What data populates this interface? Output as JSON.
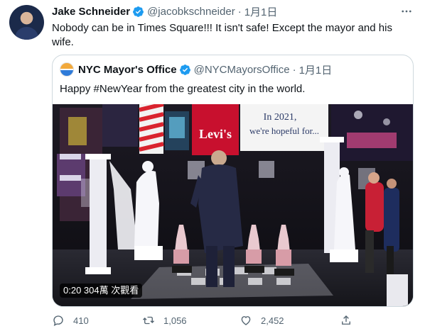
{
  "author": {
    "name": "Jake Schneider",
    "handle": "@jacobkschneider",
    "separator": "·",
    "date": "1月1日",
    "avatar_icon": "user-avatar"
  },
  "tweet_text": "Nobody can be in Times Square!!! It isn't safe! Except the mayor and his wife.",
  "quoted": {
    "name": "NYC Mayor's Office",
    "handle": "@NYCMayorsOffice",
    "separator": "·",
    "date": "1月1日",
    "text": "Happy #NewYear from the greatest city in the world.",
    "video": {
      "badge": "0:20  304萬 次觀看",
      "billboards": {
        "brand": "Levi's",
        "message_line1": "In 2021,",
        "message_line2": "we're hopeful for..."
      }
    }
  },
  "actions": {
    "reply_count": "410",
    "retweet_count": "1,056",
    "like_count": "2,452"
  },
  "colors": {
    "verified": "#1d9bf0",
    "secondary_text": "#536471",
    "border": "#cfd9de"
  },
  "icons": [
    "verified-badge-icon",
    "more-options-icon",
    "reply-icon",
    "retweet-icon",
    "like-icon",
    "share-icon"
  ]
}
